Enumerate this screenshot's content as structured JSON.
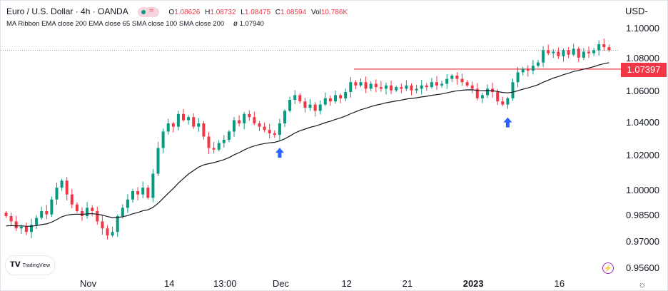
{
  "header": {
    "symbol": "Euro / U.S. Dollar · 4h · OANDA",
    "open_label": "O",
    "open": "1.08626",
    "high_label": "H",
    "high": "1.08732",
    "low_label": "L",
    "low": "1.08475",
    "close_label": "C",
    "close": "1.08594",
    "vol_label": "Vol",
    "vol": "10.786K",
    "indicator": "MA Ribbon EMA close 200 EMA close 65 SMA close 100 SMA close 200",
    "indicator_symbol": "ø",
    "indicator_value": "1.07940",
    "wave_icon": "≈"
  },
  "axis": {
    "currency": "USD",
    "currency_arrow": "-",
    "gear": "☼",
    "bolt": "⚡"
  },
  "branding": {
    "name": "TradingView",
    "logo": "TV"
  },
  "chart_data": {
    "type": "candlestick",
    "title": "Euro / U.S. Dollar · 4h · OANDA",
    "y_ticks": [
      "1.10000",
      "1.08000",
      "1.06000",
      "1.04000",
      "1.02000",
      "1.00000",
      "0.98500",
      "0.97000",
      "0.95600"
    ],
    "y_tick_values": [
      1.1,
      1.08,
      1.06,
      1.04,
      1.02,
      1.0,
      0.985,
      0.97,
      0.956
    ],
    "x_ticks": [
      "Nov",
      "14",
      "13:00",
      "Dec",
      "12",
      "21",
      "2023",
      "16"
    ],
    "x_tick_bold": [
      false,
      false,
      false,
      false,
      false,
      false,
      true,
      false
    ],
    "x_tick_bar_index": [
      16,
      32,
      43,
      54,
      67,
      79,
      92,
      109
    ],
    "closes": [
      0.985,
      0.982,
      0.978,
      0.979,
      0.976,
      0.98,
      0.984,
      0.988,
      0.986,
      0.995,
      1.002,
      1.006,
      0.998,
      0.992,
      0.988,
      0.985,
      0.99,
      0.988,
      0.982,
      0.978,
      0.974,
      0.976,
      0.985,
      0.99,
      0.995,
      1.0,
      0.998,
      1.002,
      0.996,
      1.01,
      1.025,
      1.035,
      1.04,
      1.038,
      1.046,
      1.042,
      1.044,
      1.038,
      1.04,
      1.032,
      1.025,
      1.024,
      1.028,
      1.03,
      1.035,
      1.042,
      1.04,
      1.046,
      1.044,
      1.04,
      1.038,
      1.036,
      1.034,
      1.033,
      1.04,
      1.048,
      1.055,
      1.058,
      1.054,
      1.05,
      1.052,
      1.048,
      1.052,
      1.056,
      1.054,
      1.058,
      1.056,
      1.06,
      1.066,
      1.064,
      1.066,
      1.062,
      1.065,
      1.063,
      1.062,
      1.064,
      1.061,
      1.063,
      1.062,
      1.064,
      1.061,
      1.062,
      1.064,
      1.063,
      1.066,
      1.064,
      1.065,
      1.068,
      1.07,
      1.068,
      1.066,
      1.064,
      1.062,
      1.056,
      1.058,
      1.062,
      1.06,
      1.054,
      1.052,
      1.056,
      1.066,
      1.072,
      1.074,
      1.073,
      1.076,
      1.078,
      1.086,
      1.084,
      1.085,
      1.082,
      1.086,
      1.083,
      1.087,
      1.081,
      1.085,
      1.084,
      1.086,
      1.09,
      1.088,
      1.08594
    ],
    "ma_seed": 0.979,
    "horizontal_level": {
      "value": 1.07397,
      "label": "1.07397",
      "from_bar": 69
    },
    "last_price": 1.08594,
    "arrows_at_bars": [
      54,
      99
    ],
    "colors": {
      "up": "#089981",
      "down": "#f23645",
      "ma": "#131722",
      "level": "#f23645",
      "arrow": "#2962ff"
    }
  }
}
